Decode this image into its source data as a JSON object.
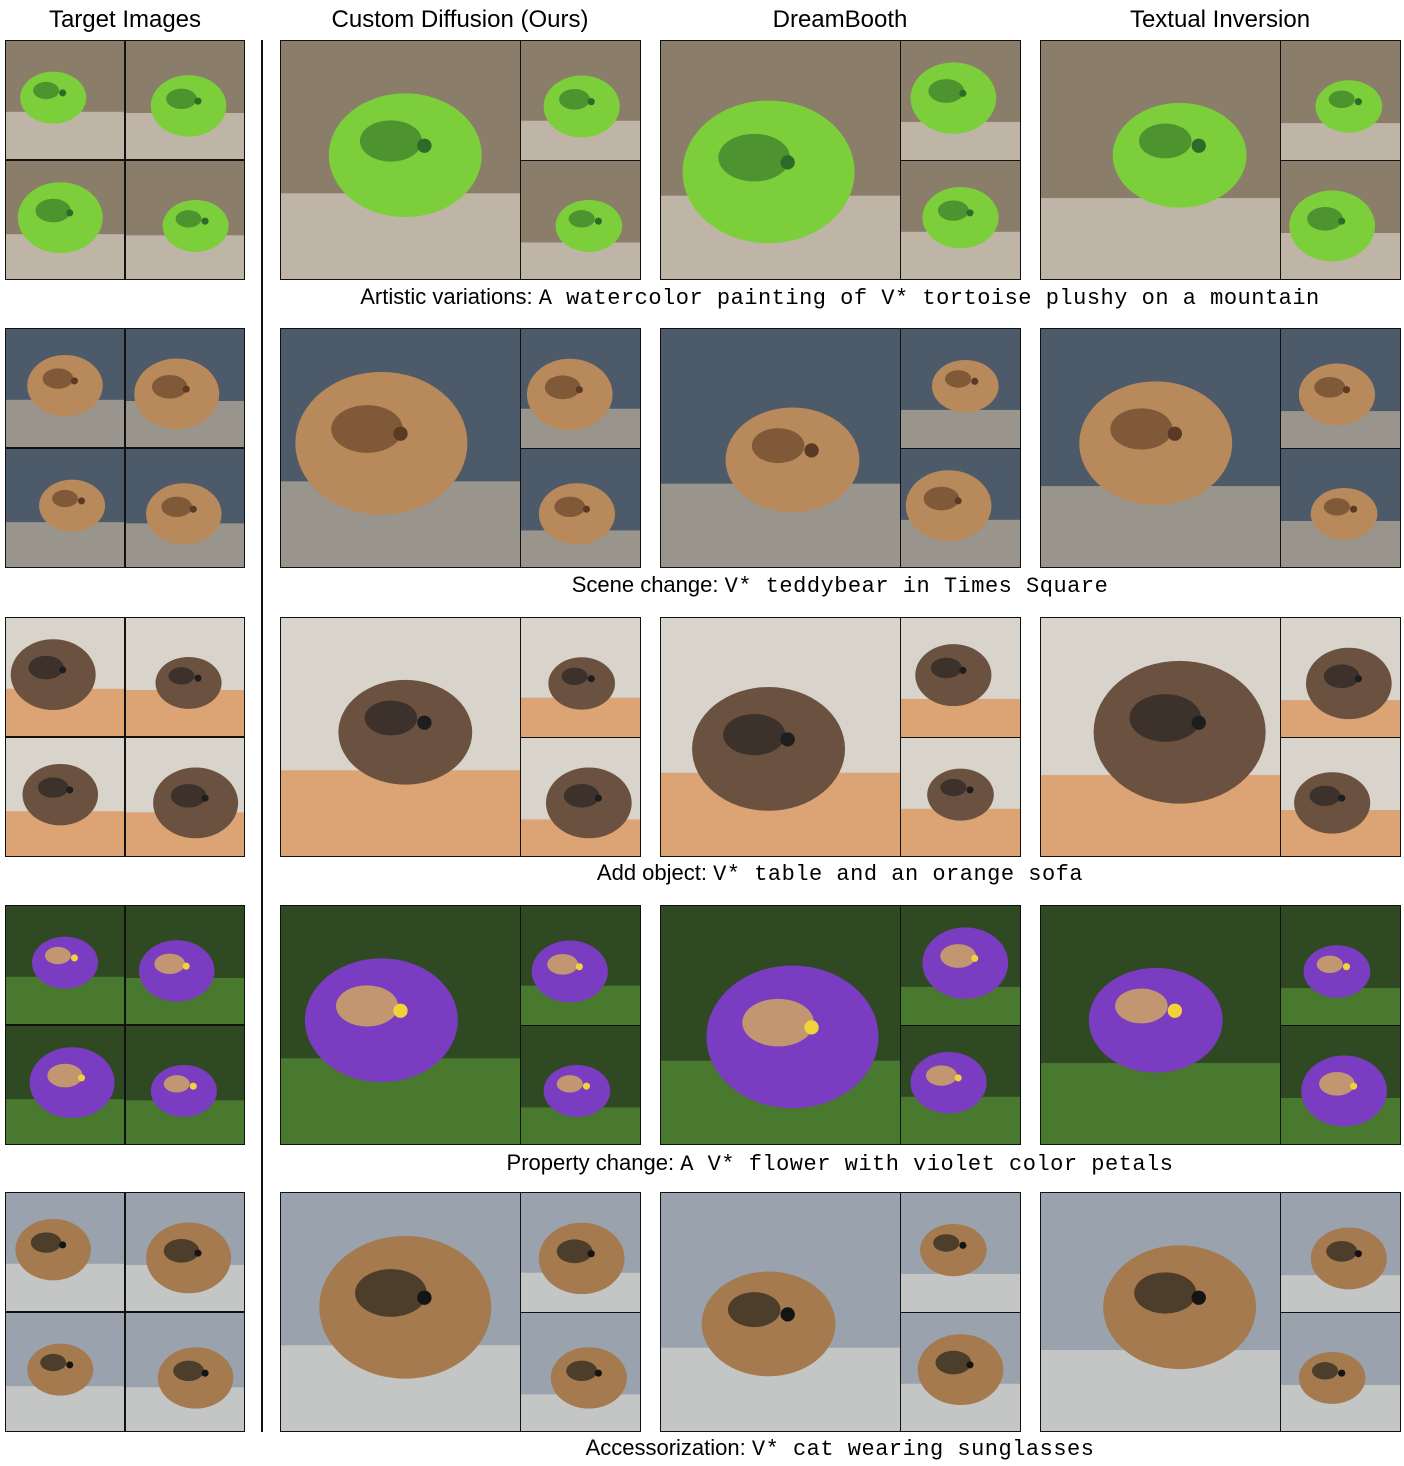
{
  "columns": {
    "target": "Target Images",
    "custom": "Custom Diffusion (Ours)",
    "dreambooth": "DreamBooth",
    "textual": "Textual Inversion"
  },
  "rows": [
    {
      "label": "Artistic variations",
      "sep": ": ",
      "prompt": "A watercolor painting of V* tortoise plushy on a mountain",
      "palette": {
        "bg": "#8a7d6a",
        "main": "#7ccf3a",
        "accent": "#2e6a2a",
        "light": "#e9e4d8"
      }
    },
    {
      "label": "Scene change",
      "sep": ": ",
      "prompt": "V* teddybear in Times Square",
      "palette": {
        "bg": "#4c5a6a",
        "main": "#b8895a",
        "accent": "#5a3a22",
        "light": "#d9c7a8"
      }
    },
    {
      "label": "Add object",
      "sep": ": ",
      "prompt": "V* table and an orange sofa",
      "palette": {
        "bg": "#d8d4cc",
        "main": "#6b5240",
        "accent": "#1e1e1e",
        "light": "#e07a2e"
      }
    },
    {
      "label": "Property change",
      "sep": ": ",
      "prompt": "A V* flower with violet color petals",
      "palette": {
        "bg": "#2f4a22",
        "main": "#7a3cc0",
        "accent": "#f2d23a",
        "light": "#5fa03a"
      }
    },
    {
      "label": "Accessorization",
      "sep": ": ",
      "prompt": "V* cat wearing sunglasses",
      "palette": {
        "bg": "#9aa3ad",
        "main": "#a47a4e",
        "accent": "#141414",
        "light": "#e8e2d8"
      }
    }
  ]
}
